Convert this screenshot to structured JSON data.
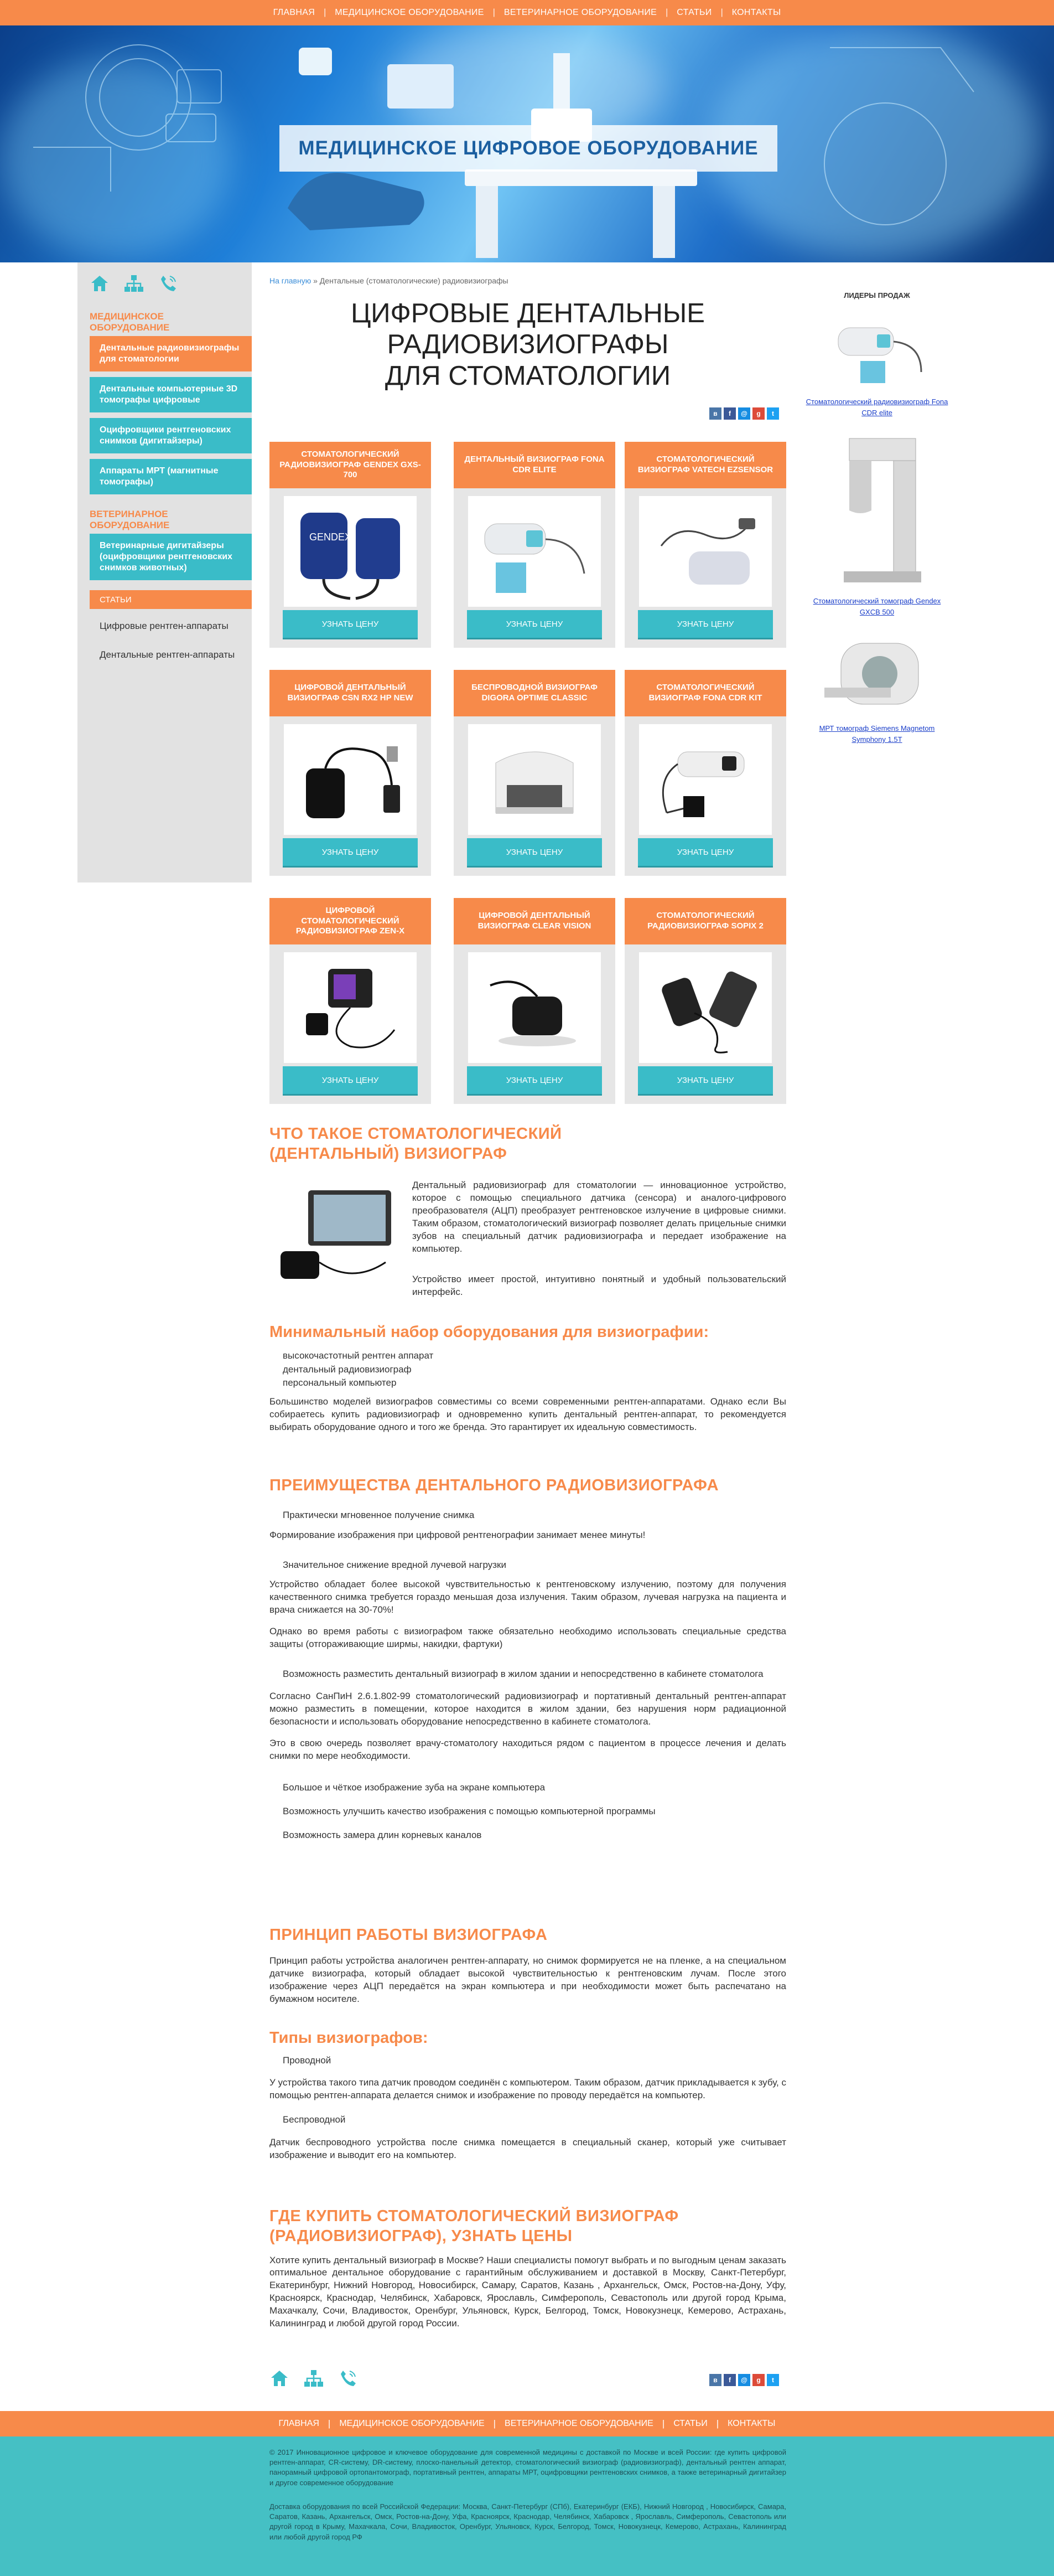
{
  "nav": {
    "items": [
      "ГЛАВНАЯ",
      "МЕДИЦИНСКОЕ ОБОРУДОВАНИЕ",
      "ВЕТЕРИНАРНОЕ ОБОРУДОВАНИЕ",
      "СТАТЬИ",
      "КОНТАКТЫ"
    ]
  },
  "hero": {
    "title": "МЕДИЦИНСКОЕ ЦИФРОВОЕ ОБОРУДОВАНИЕ"
  },
  "sidebar": {
    "sec1": "МЕДИЦИНСКОЕ ОБОРУДОВАНИЕ",
    "items": [
      {
        "label": "Дентальные радиовизиографы для стоматологии",
        "active": true
      },
      {
        "label": "Дентальные компьютерные 3D томографы цифровые",
        "active": false
      },
      {
        "label": "Оцифровщики рентгеновских снимков (дигитайзеры)",
        "active": false
      },
      {
        "label": "Аппараты МРТ (магнитные томографы)",
        "active": false
      }
    ],
    "sec2": "ВЕТЕРИНАРНОЕ ОБОРУДОВАНИЕ",
    "vet_item": "Ветеринарные дигитайзеры (оцифровщики рентгеновских снимков животных)",
    "articles_label": "СТАТЬИ",
    "articles": [
      "Цифровые рентген-аппараты",
      "Дентальные рентген-аппараты"
    ]
  },
  "breadcrumb": {
    "home": "На главную",
    "sep": " » ",
    "current": "Дентальные (стоматологические) радиовизиографы"
  },
  "title": {
    "line1": "ЦИФРОВЫЕ ДЕНТАЛЬНЫЕ",
    "line2": "РАДИОВИЗИОГРАФЫ",
    "line3": "ДЛЯ СТОМАТОЛОГИИ"
  },
  "products": [
    {
      "name": "СТОМАТОЛОГИЧЕСКИЙ РАДИОВИЗИОГРАФ GENDEX GXS-700",
      "btn": "УЗНАТЬ ЦЕНУ",
      "icon": "gendex-sensor-icon"
    },
    {
      "name": "ДЕНТАЛЬНЫЙ ВИЗИОГРАФ FONA CDR ELITE",
      "btn": "УЗНАТЬ ЦЕНУ",
      "icon": "fona-sensor-icon"
    },
    {
      "name": "СТОМАТОЛОГИЧЕСКИЙ ВИЗИОГРАФ VATECH EZSENSOR",
      "btn": "УЗНАТЬ ЦЕНУ",
      "icon": "vatech-sensor-icon"
    },
    {
      "name": "ЦИФРОВОЙ ДЕНТАЛЬНЫЙ ВИЗИОГРАФ CSN RX2 HP NEW",
      "btn": "УЗНАТЬ ЦЕНУ",
      "icon": "csn-sensor-icon"
    },
    {
      "name": "БЕСПРОВОДНОЙ ВИЗИОГРАФ DIGORA OPTIME CLASSIC",
      "btn": "УЗНАТЬ ЦЕНУ",
      "icon": "digora-scanner-icon"
    },
    {
      "name": "СТОМАТОЛОГИЧЕСКИЙ ВИЗИОГРАФ FONA CDR KIT",
      "btn": "УЗНАТЬ ЦЕНУ",
      "icon": "fona-kit-icon"
    },
    {
      "name": "ЦИФРОВОЙ СТОМАТОЛОГИЧЕСКИЙ РАДИОВИЗИОГРАФ ZEN-X",
      "btn": "УЗНАТЬ ЦЕНУ",
      "icon": "zenx-sensor-icon"
    },
    {
      "name": "ЦИФРОВОЙ ДЕНТАЛЬНЫЙ ВИЗИОГРАФ CLEAR VISION",
      "btn": "УЗНАТЬ ЦЕНУ",
      "icon": "clearvision-sensor-icon"
    },
    {
      "name": "СТОМАТОЛОГИЧЕСКИЙ РАДИОВИЗИОГРАФ SOPIX 2",
      "btn": "УЗНАТЬ ЦЕНУ",
      "icon": "sopix-sensor-icon"
    }
  ],
  "sales": {
    "title": "ЛИДЕРЫ ПРОДАЖ",
    "items": [
      {
        "label": "Стоматологический радиовизиограф Fona CDR elite"
      },
      {
        "label": "Стоматологический томограф Gendex GXCB 500"
      },
      {
        "label": "МРТ томограф Siemens Magnetom Symphony 1.5T"
      }
    ]
  },
  "about": {
    "title": "ЧТО ТАКОЕ СТОМАТОЛОГИЧЕСКИЙ (ДЕНТАЛЬНЫЙ) ВИЗИОГРАФ",
    "p1": "Дентальный радиовизиограф для стоматологии — инновационное устройство, которое с помощью специального датчика (сенсора) и аналого-цифрового преобразователя (АЦП) преобразует рентгеновское излучение в цифровые снимки. Таким образом, стоматологический визиограф позволяет делать прицельные снимки зубов на специальный датчик радиовизиографа и передает изображение на компьютер.",
    "p2": "Устройство имеет простой, интуитивно понятный и удобный пользовательский интерфейс."
  },
  "minimal": {
    "title": "Минимальный набор оборудования для визиографии:",
    "items": [
      "высокочастотный рентген аппарат",
      "дентальный радиовизиограф",
      "персональный компьютер"
    ],
    "p": "Большинство моделей визиографов совместимы со всеми современными рентген-аппаратами. Однако если Вы собираетесь купить радиовизиограф и одновременно купить дентальный рентген-аппарат, то рекомендуется выбирать оборудование одного и того же бренда. Это гарантирует их идеальную совместимость."
  },
  "benefits": {
    "title": "ПРЕИМУЩЕСТВА ДЕНТАЛЬНОГО РАДИОВИЗИОГРАФА",
    "b1": "Практически мгновенное получение снимка",
    "b1p": "Формирование изображения при цифровой рентгенографии занимает менее минуты!",
    "b2": "Значительное снижение вредной лучевой нагрузки",
    "b2p1": "Устройство обладает более высокой чувствительностью к рентгеновскому излучению, поэтому для получения качественного снимка требуется гораздо меньшая доза излучения. Таким образом, лучевая нагрузка на пациента и врача снижается на 30-70%!",
    "b2p2": "Однако во время работы с визиографом также обязательно необходимо использовать специальные средства защиты (отгораживающие ширмы, накидки, фартуки)",
    "b3": "Возможность разместить дентальный визиограф в жилом здании и непосредственно в кабинете стоматолога",
    "b3p1": "Согласно СанПиН 2.6.1.802-99 стоматологический радиовизиограф и портативный дентальный рентген-аппарат можно разместить в помещении, которое находится в жилом здании, без нарушения норм радиационной безопасности и использовать оборудование непосредственно в кабинете стоматолога.",
    "b3p2": "Это в свою очередь позволяет врачу-стоматологу находиться рядом с пациентом в процессе лечения и делать снимки по мере необходимости.",
    "b4": "Большое и чёткое изображение зуба на экране компьютера",
    "b5": "Возможность улучшить качество изображения с помощью компьютерной программы",
    "b6": "Возможность замера длин корневых каналов"
  },
  "principle": {
    "title": "ПРИНЦИП РАБОТЫ ВИЗИОГРАФА",
    "p": "Принцип работы устройства аналогичен рентген-аппарату, но снимок формируется не на пленке, а на специальном датчике визиографа, который обладает высокой чувствительностью к рентгеновским лучам. После этого изображение через АЦП передаётся на экран компьютера и при необходимости может быть распечатано на бумажном носителе."
  },
  "types": {
    "title": "Типы визиографов:",
    "t1": "Проводной",
    "t1p": "У устройства такого типа датчик проводом соединён с компьютером. Таким образом, датчик прикладывается к зубу, с помощью рентген-аппарата делается снимок и изображение по проводу передаётся на компьютер.",
    "t2": "Беспроводной",
    "t2p": "Датчик беспроводного устройства после снимка помещается в специальный сканер, который уже считывает изображение и выводит его на компьютер."
  },
  "buy": {
    "title": "ГДЕ КУПИТЬ СТОМАТОЛОГИЧЕСКИЙ ВИЗИОГРАФ (РАДИОВИЗИОГРАФ), УЗНАТЬ ЦЕНЫ",
    "p": "Хотите купить дентальный визиограф в Москве? Наши специалисты помогут выбрать и по выгодным ценам заказать оптимальное дентальное оборудование с гарантийным обслуживанием и доставкой в Москву, Санкт-Петербург, Екатеринбург, Нижний Новгород, Новосибирск, Самару, Саратов, Казань , Архангельск, Омск, Ростов-на-Дону, Уфу, Красноярск, Краснодар, Челябинск, Хабаровск, Ярославль, Симферополь, Севастополь или другой город Крыма, Махачкалу, Сочи, Владивосток, Оренбург, Ульяновск, Курск, Белгород, Томск, Новокузнецк, Кемерово, Астрахань, Калининград и любой другой город России."
  },
  "footer": {
    "p1": "© 2017 Инновационное цифровое и ключевое оборудование для современной медицины с доставкой по Москве и всей России: где купить цифровой рентген-аппарат, CR-систему, DR-систему, плоско-панельный детектор, стоматологический визиограф (радиовизиограф), дентальный рентген аппарат, панорамный цифровой ортопантомограф, портативный рентген, аппараты МРТ, оцифровщики рентгеновских снимков, а также ветеринарный дигитайзер и другое современное оборудование",
    "p2": "Доставка оборудования по всей Российской Федерации: Москва, Санкт-Петербург (СПб), Екатеринбург (ЕКБ), Нижний Новгород , Новосибирск, Самара, Саратов, Казань, Архангельск, Омск, Ростов-на-Дону, Уфа, Красноярск, Краснодар, Челябинск, Хабаровск , Ярославль, Симферополь, Севастополь или другой город в Крыму, Махачкала, Сочи, Владивосток, Оренбург, Ульяновск, Курск, Белгород, Томск, Новокузнецк, Кемерово, Астрахань, Калининград или любой другой город РФ"
  },
  "colors": {
    "accent": "#f78a4a",
    "teal": "#3abcc8",
    "footer": "#45c0c4"
  }
}
